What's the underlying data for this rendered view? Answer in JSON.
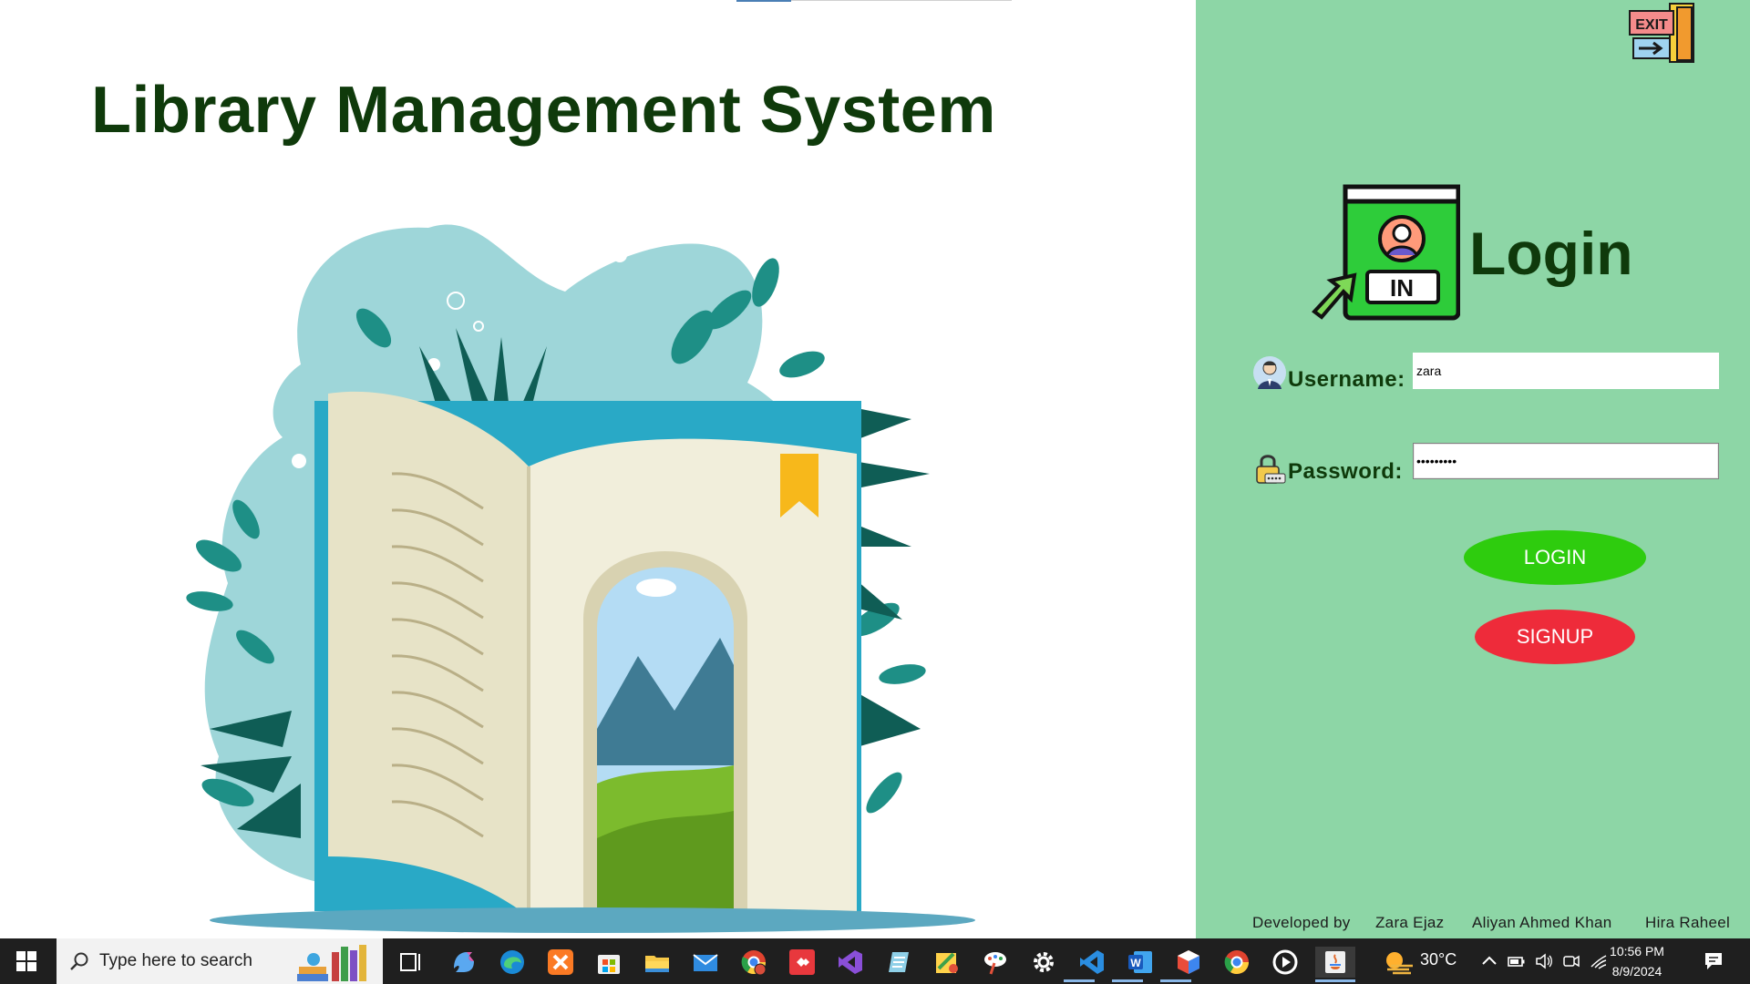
{
  "app": {
    "title": "Library Management System"
  },
  "login": {
    "heading": "Login",
    "logo_badge": "IN",
    "exit_sign": "EXIT",
    "username_label": "Username:",
    "username_value": "zara",
    "password_label": "Password:",
    "password_value": "zara12345",
    "login_button": "LOGIN",
    "signup_button": "SIGNUP"
  },
  "credits": {
    "developed_by": "Developed by",
    "dev1": "Zara Ejaz",
    "dev2": "Aliyan Ahmed Khan",
    "dev3": "Hira Raheel"
  },
  "taskbar": {
    "search_placeholder": "Type here to search",
    "icons": [
      "windows-start-icon",
      "search-icon",
      "books-icon",
      "task-view-icon",
      "copilot-icon",
      "edge-icon",
      "xampp-icon",
      "store-icon",
      "file-explorer-icon",
      "mail-icon",
      "chrome-profile-icon",
      "anydesk-icon",
      "visual-studio-icon",
      "notepad-icon",
      "paint-tool-icon",
      "paint-brush-icon",
      "settings-icon",
      "vscode-icon",
      "word-icon",
      "cube-app-icon",
      "chrome-icon",
      "media-player-icon",
      "java-icon",
      "weather-icon",
      "chevron-up-icon",
      "battery-icon",
      "volume-icon",
      "camera-icon",
      "wifi-icon",
      "notification-icon"
    ],
    "weather": "30°C",
    "time": "10:56 PM",
    "date": "8/9/2024"
  },
  "colors": {
    "panel_bg": "#8dd6a6",
    "title_color": "#0f3a0b",
    "login_button": "#2ecc0e",
    "signup_button": "#ee2b3a",
    "taskbar_bg": "#1f1f1f"
  }
}
